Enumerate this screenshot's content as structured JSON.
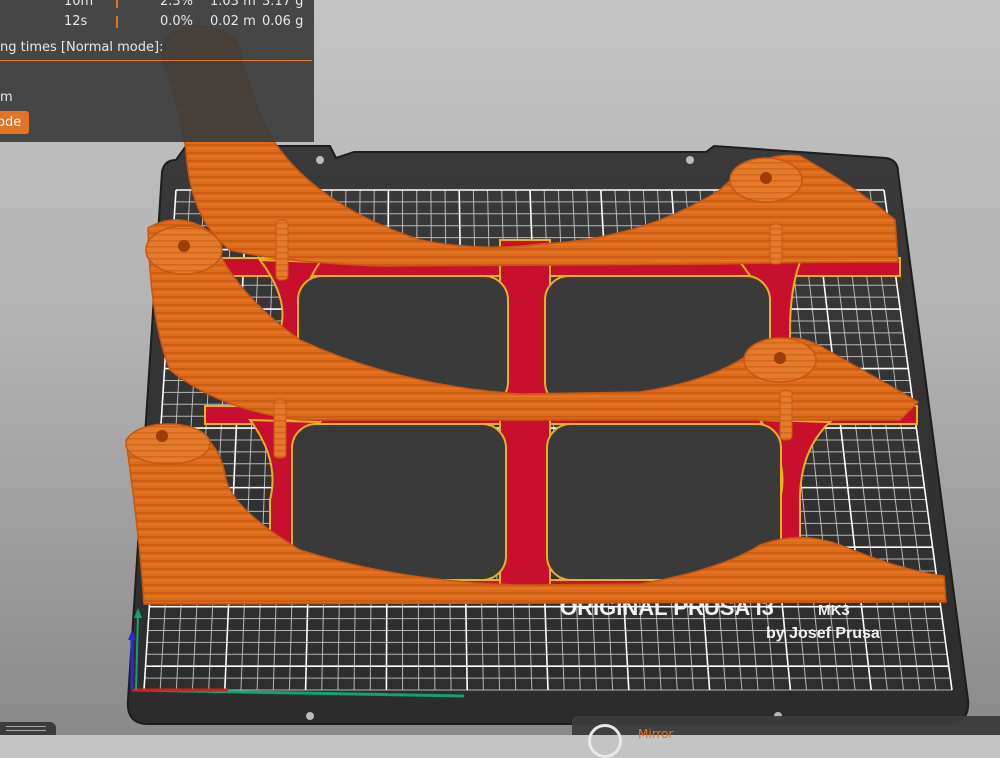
{
  "legend": {
    "rows": [
      {
        "time": "10m",
        "percent": "2.3%",
        "length": "1.03 m",
        "weight": "3.17 g"
      },
      {
        "time": "12s",
        "percent": "0.0%",
        "length": "0.02 m",
        "weight": "0.06 g"
      }
    ],
    "title": "ng times [Normal mode]:",
    "time_value": "m",
    "mode_button": "ode"
  },
  "bed": {
    "brand_line1": "ORIGINAL PRUSA I3",
    "brand_model": "MK3",
    "brand_line2": "by Josef Prusa"
  },
  "bottom_panel": {
    "item_label": "Mirror"
  },
  "colors": {
    "perimeter_orange": "#e27425",
    "infill_red": "#c8102e",
    "bed_dark": "#333333",
    "grid_line": "#c8c8c8",
    "panel_bg": "#3c3c3c"
  },
  "icons": [
    "axis-gizmo",
    "mirror-icon"
  ]
}
